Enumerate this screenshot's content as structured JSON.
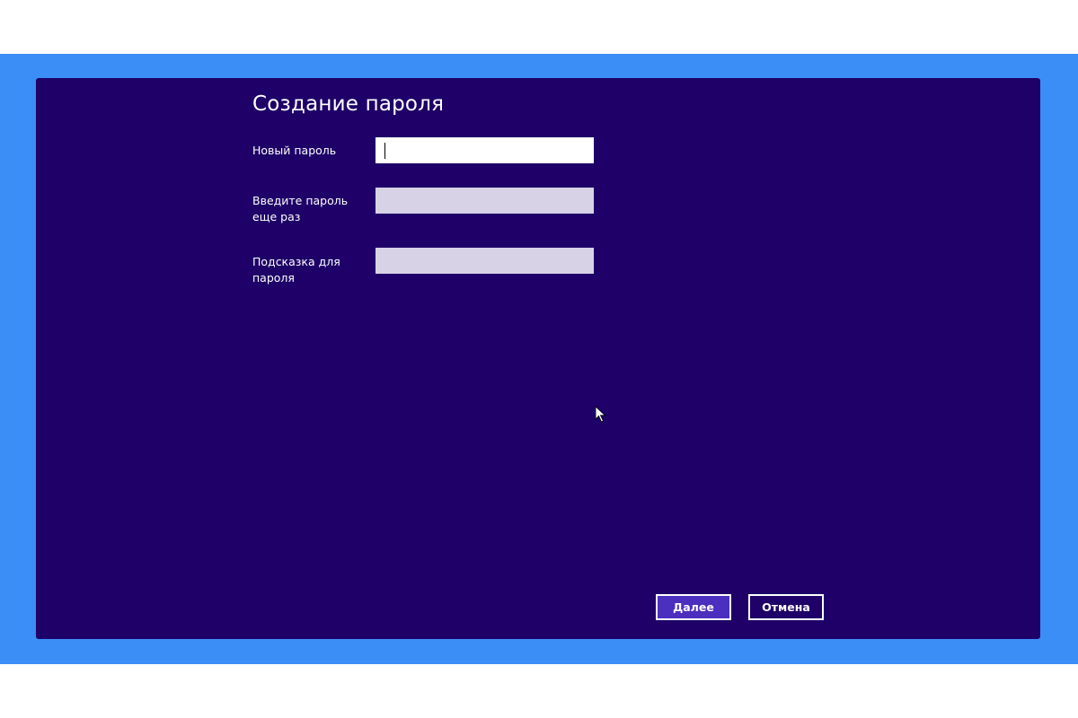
{
  "dialog": {
    "title": "Создание пароля",
    "fields": [
      {
        "label": "Новый пароль",
        "value": "",
        "placeholder": ""
      },
      {
        "label": "Введите пароль еще раз",
        "value": "",
        "placeholder": ""
      },
      {
        "label": "Подсказка для пароля",
        "value": "",
        "placeholder": ""
      }
    ],
    "buttons": {
      "next": "Далее",
      "cancel": "Отмена"
    }
  },
  "colors": {
    "frame_blue": "#3a8ef6",
    "screen_background": "#1e0068",
    "primary_button": "#4b2fbf",
    "inactive_field": "#d8d2e6"
  },
  "icons": {
    "pointer": "mouse-pointer-icon"
  }
}
